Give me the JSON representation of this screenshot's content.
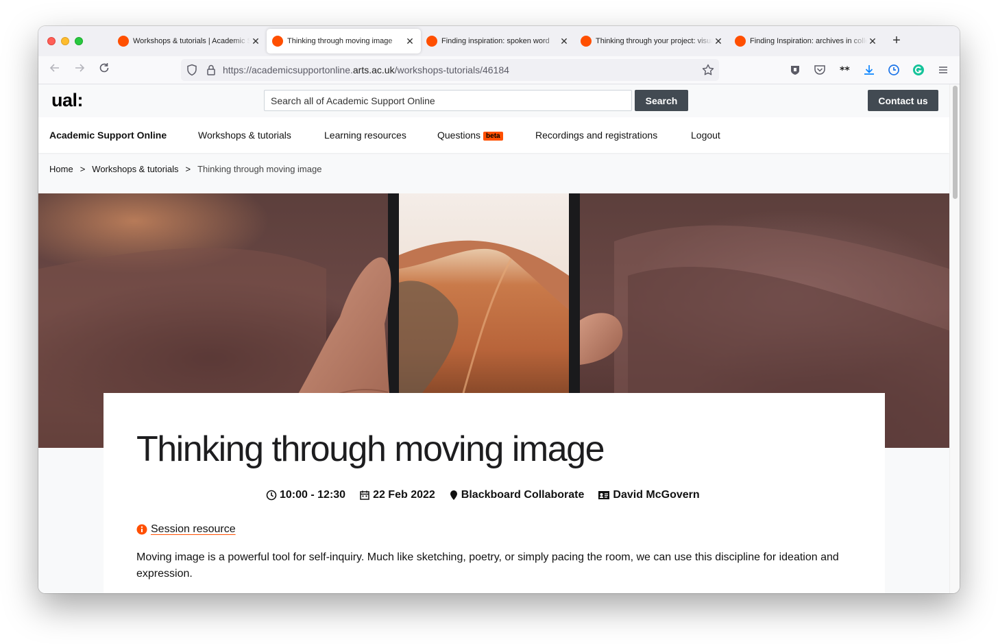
{
  "browser": {
    "tabs": [
      {
        "title": "Workshops & tutorials | Academic Support Online",
        "active": false
      },
      {
        "title": "Thinking through moving image",
        "active": true
      },
      {
        "title": "Finding inspiration: spoken word",
        "active": false
      },
      {
        "title": "Thinking through your project: visual",
        "active": false
      },
      {
        "title": "Finding Inspiration: archives in collections",
        "active": false
      }
    ],
    "url_prefix": "https://academicsupportonline.",
    "url_domain": "arts.ac.uk",
    "url_path": "/workshops-tutorials/46184"
  },
  "site": {
    "logo": "ual:",
    "search_placeholder": "Search all of Academic Support Online",
    "search_button": "Search",
    "contact_button": "Contact us",
    "nav": {
      "brand": "Academic Support Online",
      "workshops": "Workshops & tutorials",
      "learning": "Learning resources",
      "questions": "Questions",
      "questions_badge": "beta",
      "recordings": "Recordings and registrations",
      "logout": "Logout"
    },
    "breadcrumb": {
      "home": "Home",
      "section": "Workshops & tutorials",
      "current": "Thinking through moving image",
      "separator": ">"
    }
  },
  "session": {
    "title": "Thinking through moving image",
    "time": "10:00 - 12:30",
    "date": "22 Feb 2022",
    "location": "Blackboard Collaborate",
    "presenter": "David McGovern",
    "resource_link": "Session resource",
    "description": "Moving image is a powerful tool for self-inquiry. Much like sketching, poetry, or simply pacing the room, we can use this discipline for ideation and expression."
  },
  "colors": {
    "accent": "#ff4f00",
    "button_dark": "#424a52"
  }
}
